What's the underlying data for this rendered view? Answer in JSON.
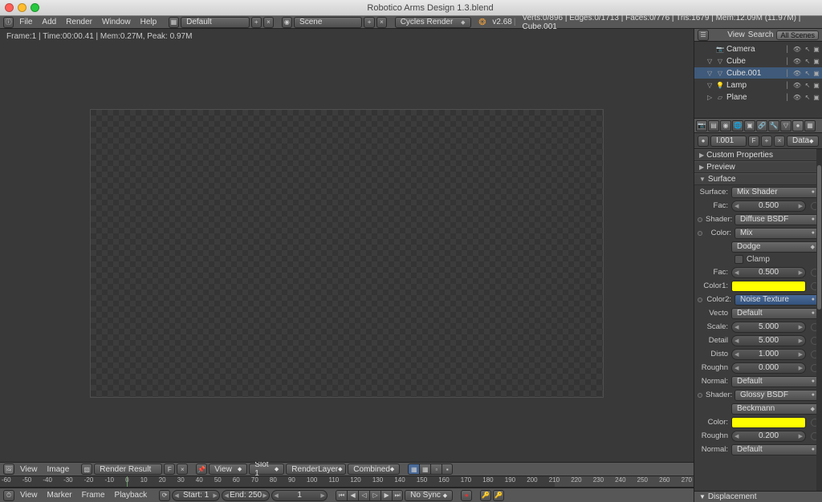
{
  "titlebar": {
    "title": "Robotico Arms Design 1.3.blend"
  },
  "header": {
    "menus": [
      "File",
      "Add",
      "Render",
      "Window",
      "Help"
    ],
    "layout_label": "Default",
    "scene_label": "Scene",
    "engine_label": "Cycles Render",
    "version": "v2.68",
    "stats": "Verts:0/896 | Edges:0/1713 | Faces:0/776 | Tris:1679 | Mem:12.09M (11.97M) | Cube.001"
  },
  "viewport": {
    "info": "Frame:1 | Time:00:00.41 | Mem:0.27M, Peak: 0.97M"
  },
  "image_header": {
    "menus": [
      "View",
      "Image"
    ],
    "image_name": "Render Result",
    "F": "F",
    "view_dd": "View",
    "slot": "Slot 1",
    "layer": "RenderLayer",
    "pass": "Combined"
  },
  "ruler": {
    "ticks": [
      "-60",
      "-50",
      "-40",
      "-30",
      "-20",
      "-10",
      "0",
      "10",
      "20",
      "30",
      "40",
      "50",
      "60",
      "70",
      "80",
      "90",
      "100",
      "110",
      "120",
      "130",
      "140",
      "150",
      "160",
      "170",
      "180",
      "190",
      "200",
      "210",
      "220",
      "230",
      "240",
      "250",
      "260",
      "270"
    ]
  },
  "timeline": {
    "menus": [
      "View",
      "Marker",
      "Frame",
      "Playback"
    ],
    "start": "Start: 1",
    "end": "End: 250",
    "current": "1",
    "sync": "No Sync"
  },
  "outliner": {
    "hdr": {
      "view": "View",
      "search": "Search",
      "all": "All Scenes"
    },
    "items": [
      {
        "icon": "cam",
        "label": "Camera",
        "sel": false
      },
      {
        "icon": "mesh",
        "label": "Cube",
        "sel": false,
        "tri": "▽"
      },
      {
        "icon": "mesh",
        "label": "Cube.001",
        "sel": true,
        "tri": "▽"
      },
      {
        "icon": "lamp",
        "label": "Lamp",
        "sel": false,
        "tri": "▽"
      },
      {
        "icon": "plane",
        "label": "Plane",
        "sel": false,
        "tri": "▷"
      }
    ]
  },
  "datablock": {
    "name": "I.001",
    "F": "F",
    "data_label": "Data"
  },
  "panels": {
    "custom_props": "Custom Properties",
    "preview": "Preview",
    "surface_hdr": "Surface",
    "displacement": "Displacement"
  },
  "surface": {
    "surface": {
      "label": "Surface:",
      "value": "Mix Shader"
    },
    "fac1": {
      "label": "Fac:",
      "value": "0.500"
    },
    "shader1": {
      "label": "Shader:",
      "value": "Diffuse BSDF"
    },
    "color_mix": {
      "label": "Color:",
      "value": "Mix"
    },
    "dodge": {
      "value": "Dodge"
    },
    "clamp": {
      "label": "Clamp"
    },
    "fac2": {
      "label": "Fac:",
      "value": "0.500"
    },
    "color1": {
      "label": "Color1:"
    },
    "color2": {
      "label": "Color2:",
      "value": "Noise Texture"
    },
    "vecto": {
      "label": "Vecto",
      "value": "Default"
    },
    "scale": {
      "label": "Scale:",
      "value": "5.000"
    },
    "detail": {
      "label": "Detail",
      "value": "5.000"
    },
    "disto": {
      "label": "Disto",
      "value": "1.000"
    },
    "roughn1": {
      "label": "Roughn",
      "value": "0.000"
    },
    "normal1": {
      "label": "Normal:",
      "value": "Default"
    },
    "shader2": {
      "label": "Shader:",
      "value": "Glossy BSDF"
    },
    "beckmann": {
      "value": "Beckmann"
    },
    "color_g": {
      "label": "Color:"
    },
    "roughn2": {
      "label": "Roughn",
      "value": "0.200"
    },
    "normal2": {
      "label": "Normal:",
      "value": "Default"
    }
  }
}
